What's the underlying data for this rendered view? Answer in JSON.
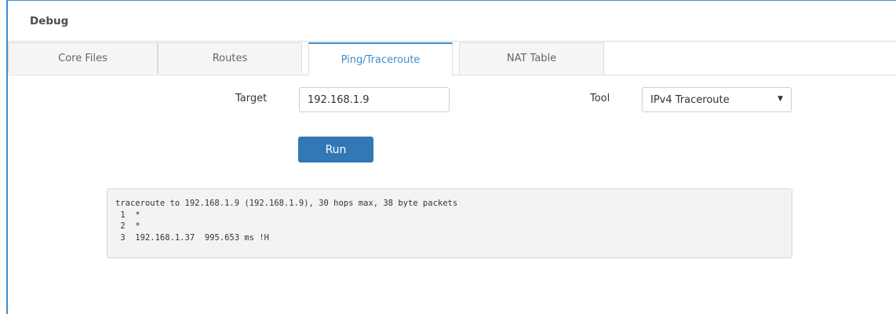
{
  "panel": {
    "title": "Debug"
  },
  "tabs": [
    {
      "label": "Core Files",
      "active": false
    },
    {
      "label": "Routes",
      "active": false
    },
    {
      "label": "Ping/Traceroute",
      "active": true
    },
    {
      "label": "NAT Table",
      "active": false
    }
  ],
  "form": {
    "target_label": "Target",
    "target_value": "192.168.1.9",
    "tool_label": "Tool",
    "tool_value": "IPv4 Traceroute",
    "run_label": "Run"
  },
  "output": {
    "lines": [
      "traceroute to 192.168.1.9 (192.168.1.9), 30 hops max, 38 byte packets",
      " 1  *",
      " 2  *",
      " 3  192.168.1.37  995.653 ms !H"
    ]
  },
  "colors": {
    "accent": "#3c8ed0",
    "button": "#3278b5"
  }
}
